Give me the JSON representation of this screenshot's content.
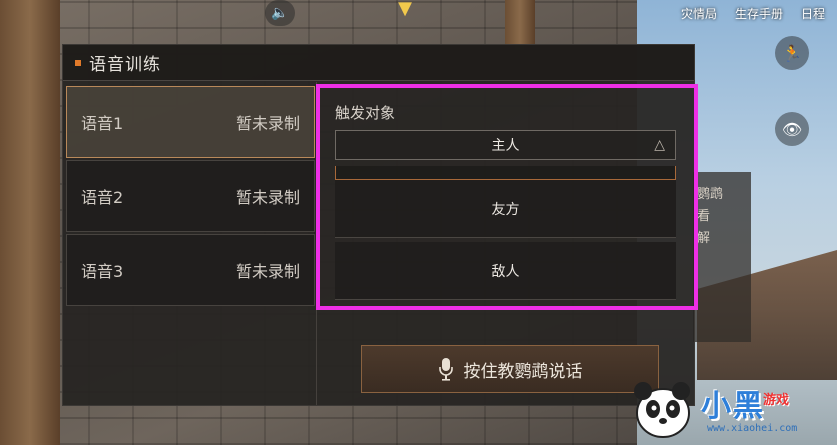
{
  "hud": {
    "top_right": [
      "灾情局",
      "生存手册",
      "日程"
    ],
    "icons": [
      "speaker-icon",
      "arrow-down-icon"
    ]
  },
  "side_panel": {
    "label": "鹦鹉",
    "label2": "看",
    "label3": "解"
  },
  "dialog": {
    "title": "语音训练",
    "voices": [
      {
        "name": "语音1",
        "status": "暂未录制",
        "active": true
      },
      {
        "name": "语音2",
        "status": "暂未录制",
        "active": false
      },
      {
        "name": "语音3",
        "status": "暂未录制",
        "active": false
      }
    ],
    "trigger": {
      "label": "触发对象",
      "selected": "主人",
      "options": [
        "友方",
        "敌人"
      ]
    },
    "record_button": "按住教鹦鹉说话"
  },
  "colors": {
    "highlight": "#ee2fe6",
    "accent": "#e07a2a",
    "active_border": "#b9895a"
  },
  "watermark": {
    "brand": "小黑",
    "sub": "游戏",
    "url": "www.xiaohei.com"
  }
}
